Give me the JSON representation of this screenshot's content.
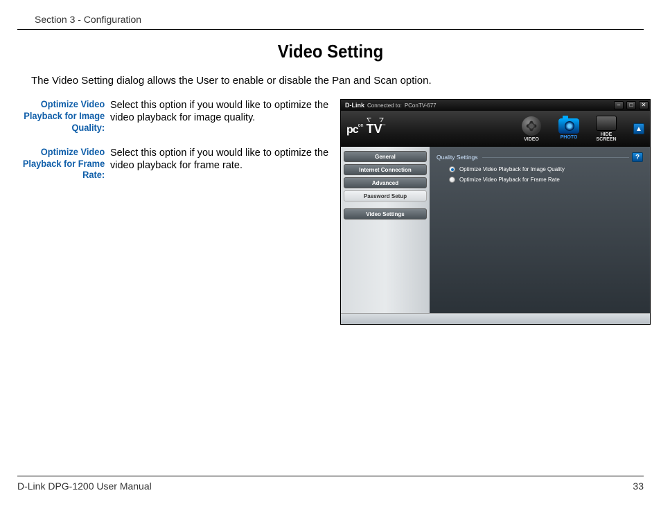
{
  "header": {
    "section": "Section 3 - Configuration"
  },
  "title": "Video Setting",
  "intro": "The Video Setting dialog allows the User to enable or disable the Pan and Scan option.",
  "definitions": [
    {
      "label": "Optimize Video Playback for Image Quality:",
      "desc": "Select this option if you would like to optimize the video playback for image quality."
    },
    {
      "label": "Optimize Video Playback for Frame Rate:",
      "desc": "Select this option if you would like to optimize the video playback for frame rate."
    }
  ],
  "app": {
    "brand": "D-Link",
    "status_label": "Connected to:",
    "status_value": "PConTV-677",
    "logo": {
      "pc": "pc",
      "on": "on",
      "tv": "TV",
      "tm": "™"
    },
    "nav": {
      "video": "VIDEO",
      "photo": "PHOTO",
      "hide": "HIDE SCREEN"
    },
    "sidebar": {
      "general": "General",
      "internet": "Internet Connection",
      "advanced": "Advanced",
      "password": "Password Setup",
      "video": "Video Settings"
    },
    "panel": {
      "title": "Quality Settings",
      "opt1": "Optimize Video Playback for Image Quality",
      "opt2": "Optimize Video Playback for Frame Rate"
    },
    "help": "?",
    "titlebar_icons": {
      "min": "–",
      "max": "□",
      "close": "✕",
      "up": "▲"
    }
  },
  "footer": {
    "manual": "D-Link DPG-1200 User Manual",
    "page": "33"
  }
}
